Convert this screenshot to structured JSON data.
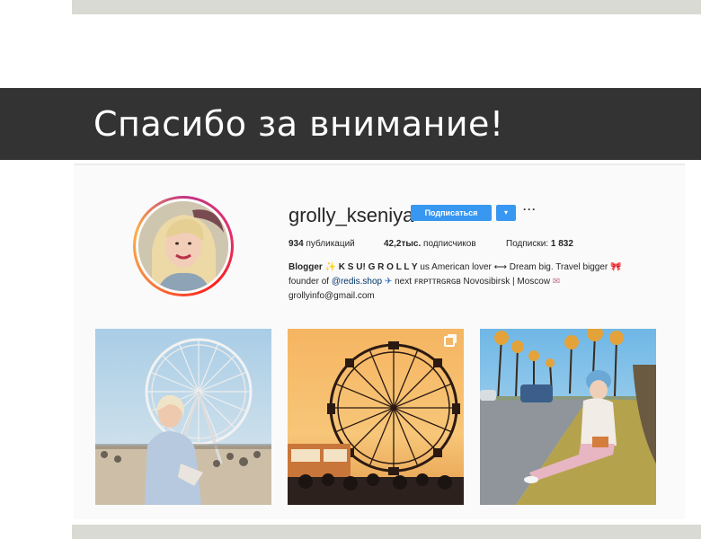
{
  "slide": {
    "title": "Спасибо за внимание!"
  },
  "profile": {
    "username": "grolly_kseniya",
    "follow_label": "Подписаться",
    "dropdown_icon": "▾",
    "more_icon": "···",
    "stats": {
      "posts_count": "934",
      "posts_label": "публикаций",
      "followers_count": "42,2тыс.",
      "followers_label": "подписчиков",
      "following_label": "Подписки:",
      "following_count": "1 832"
    },
    "bio": {
      "name": "Blogger",
      "brand": "K S U! G R O L L Y",
      "line1_rest": "us American lover ⟷ Dream big. Travel bigger",
      "line2_prefix": "founder of",
      "line2_link": "@redis.shop",
      "line2_rest": "next ꜰʀᴘᴛᴛʀɢʀɢʙ Novosibirsk | Moscow",
      "email": "grollyinfo@gmail.com"
    }
  },
  "colors": {
    "band": "#333333",
    "accent_blue": "#3897f0",
    "link": "#003569",
    "bar": "#d9dad3"
  },
  "icons": [
    "ferris-wheel-photo",
    "multi-post-icon",
    "more-icon",
    "dropdown-icon"
  ]
}
